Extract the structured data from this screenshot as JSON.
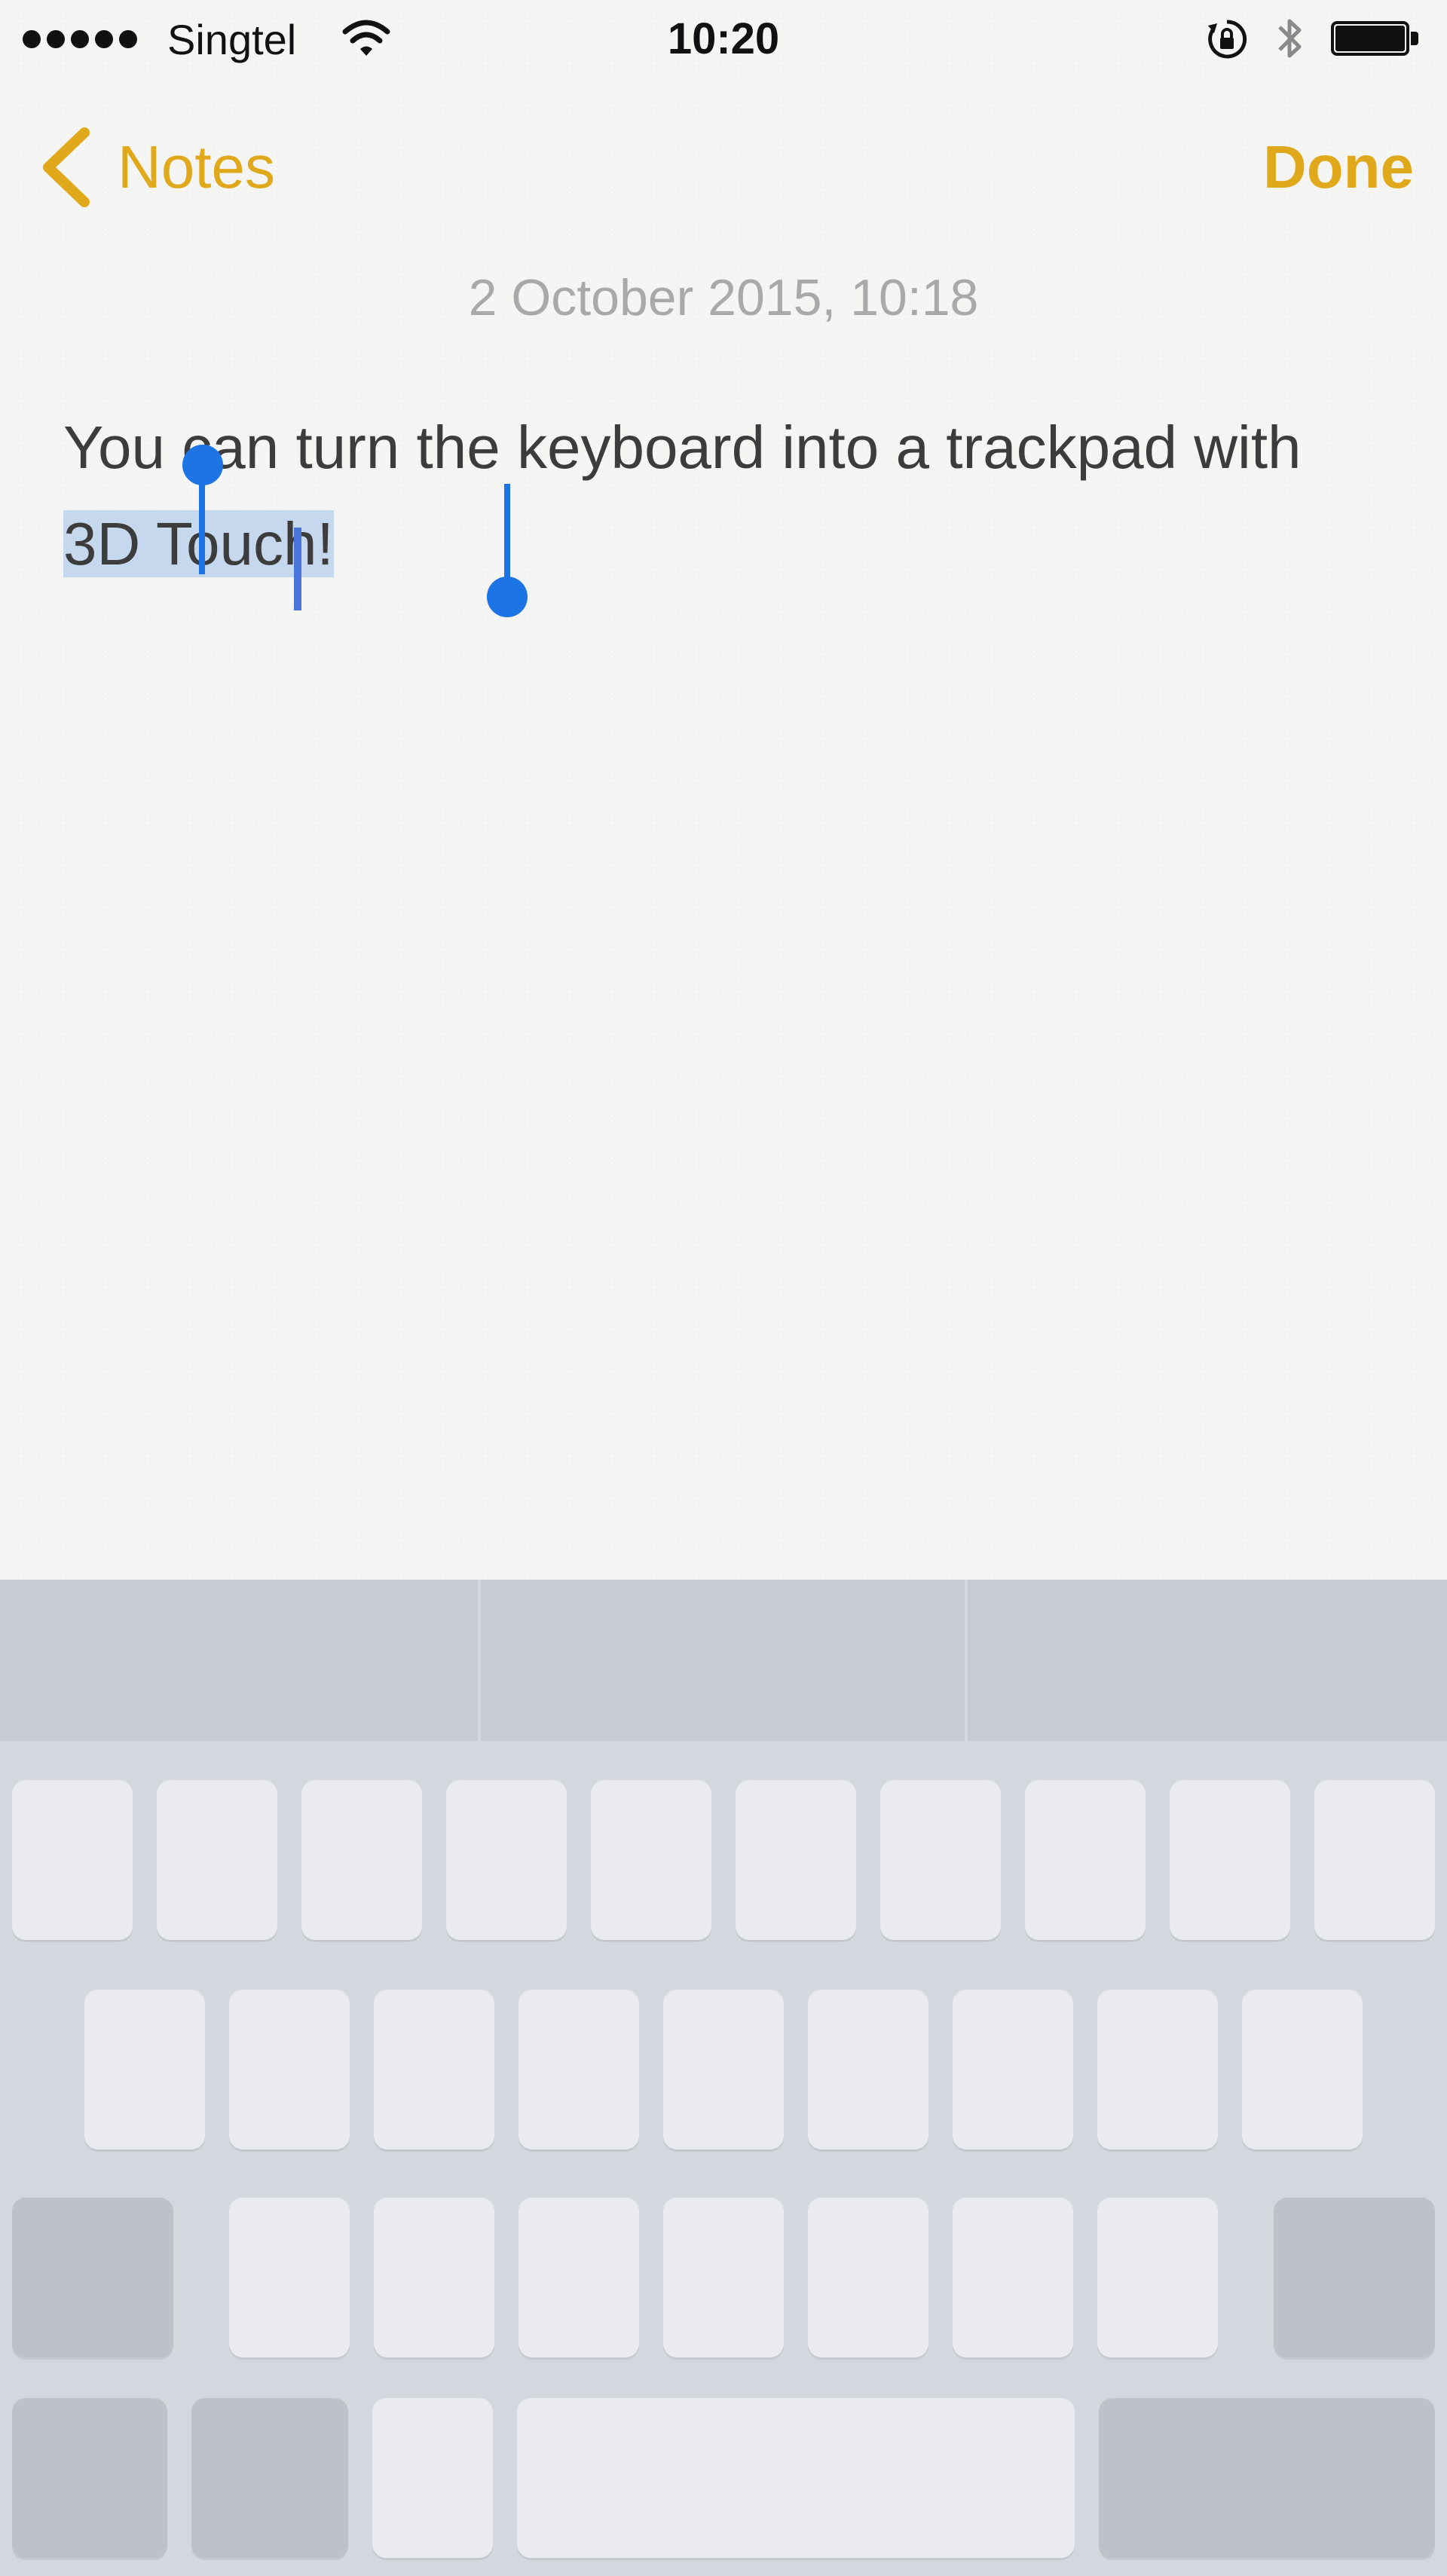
{
  "status_bar": {
    "carrier": "Singtel",
    "time": "10:20",
    "signal_bars_filled": 5,
    "battery_level": 1.0,
    "icons": [
      "signal-dots-icon",
      "wifi-icon",
      "orientation-lock-icon",
      "bluetooth-icon",
      "battery-icon"
    ]
  },
  "nav": {
    "back_label": "Notes",
    "done_label": "Done",
    "accent_color": "#e0a91b"
  },
  "note": {
    "date": "2 October 2015, 10:18",
    "text_before": "You can turn the keyboard into a trackpad with ",
    "selected_text": "3D Touch!",
    "selection_color": "#1d74e5"
  },
  "keyboard": {
    "mode": "trackpad",
    "rows": [
      10,
      9,
      9,
      4
    ]
  }
}
